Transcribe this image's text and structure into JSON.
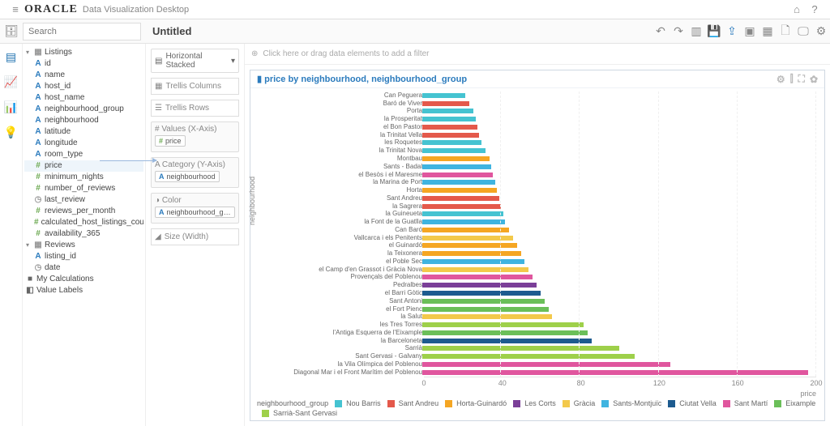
{
  "app": {
    "brand": "ORACLE",
    "subbrand": "Data Visualization Desktop"
  },
  "search": {
    "placeholder": "Search"
  },
  "canvas": {
    "title": "Untitled",
    "filter_hint": "Click here or drag data elements to add a filter"
  },
  "tree": {
    "root1": "Listings",
    "root1_items": [
      {
        "g": "A",
        "l": "id"
      },
      {
        "g": "A",
        "l": "name"
      },
      {
        "g": "A",
        "l": "host_id"
      },
      {
        "g": "A",
        "l": "host_name"
      },
      {
        "g": "A",
        "l": "neighbourhood_group"
      },
      {
        "g": "A",
        "l": "neighbourhood"
      },
      {
        "g": "A",
        "l": "latitude"
      },
      {
        "g": "A",
        "l": "longitude"
      },
      {
        "g": "A",
        "l": "room_type"
      },
      {
        "g": "H",
        "l": "price",
        "sel": true
      },
      {
        "g": "H",
        "l": "minimum_nights"
      },
      {
        "g": "H",
        "l": "number_of_reviews"
      },
      {
        "g": "C",
        "l": "last_review"
      },
      {
        "g": "H",
        "l": "reviews_per_month"
      },
      {
        "g": "H",
        "l": "calculated_host_listings_count"
      },
      {
        "g": "H",
        "l": "availability_365"
      }
    ],
    "root2": "Reviews",
    "root2_items": [
      {
        "g": "A",
        "l": "listing_id"
      },
      {
        "g": "C",
        "l": "date"
      }
    ],
    "folders": [
      {
        "g": "F",
        "l": "My Calculations"
      },
      {
        "g": "L",
        "l": "Value Labels"
      }
    ]
  },
  "grammar": {
    "viz_type": "Horizontal Stacked",
    "trellis_cols": "Trellis Columns",
    "trellis_rows": "Trellis Rows",
    "values_lbl": "Values (X-Axis)",
    "values_pill": "price",
    "category_lbl": "Category (Y-Axis)",
    "category_pill": "neighbourhood",
    "color_lbl": "Color",
    "color_pill": "neighbourhood_gr...",
    "size_lbl": "Size (Width)"
  },
  "chart": {
    "title": "price by neighbourhood, neighbourhood_group",
    "xlabel": "price",
    "ylabel": "neighbourhood",
    "legend_label": "neighbourhood_group",
    "legend_items": [
      "Nou Barris",
      "Sant Andreu",
      "Horta-Guinardó",
      "Les Corts",
      "Gràcia",
      "Sants-Montjuïc",
      "Ciutat Vella",
      "Sant Martí",
      "Eixample",
      "Sarrià-Sant Gervasi"
    ]
  },
  "chart_data": {
    "type": "bar",
    "orientation": "horizontal",
    "xlabel": "price",
    "ylabel": "neighbourhood",
    "xlim": [
      0,
      200
    ],
    "xticks": [
      0,
      40,
      80,
      120,
      160,
      200
    ],
    "color_by": "neighbourhood_group",
    "group_colors": {
      "Nou Barris": "#45c3d1",
      "Sant Andreu": "#e4594b",
      "Horta-Guinardó": "#f5a623",
      "Les Corts": "#7b3f98",
      "Gràcia": "#f3c94b",
      "Sants-Montjuïc": "#3fb4e0",
      "Ciutat Vella": "#1d5b8f",
      "Sant Martí": "#e0569e",
      "Eixample": "#6bbf59",
      "Sarrià-Sant Gervasi": "#9ed04a"
    },
    "categories": [
      "Can Peguera",
      "Baró de Viver",
      "Porta",
      "la Prosperitat",
      "el Bon Pastor",
      "la Trinitat Vella",
      "les Roquetes",
      "la Trinitat Nova",
      "Montbau",
      "Sants - Badal",
      "el Besòs i el Maresme",
      "la Marina de Port",
      "Horta",
      "Sant Andreu",
      "la Sagrera",
      "la Guineueta",
      "la Font de la Guatlla",
      "Can Baró",
      "Vallcarca i els Penitents",
      "el Guinardó",
      "la Teixonera",
      "el Poble Sec",
      "el Camp d'en Grassot i Gràcia Nova",
      "Provençals del Poblenou",
      "Pedralbes",
      "el Barri Gòtic",
      "Sant Antoni",
      "el Fort Pienc",
      "la Salut",
      "les Tres Torres",
      "l'Antiga Esquerra de l'Eixample",
      "la Barceloneta",
      "Sarrià",
      "Sant Gervasi - Galvany",
      "la Vila Olímpica del Poblenou",
      "Diagonal Mar i el Front Marítim del Poblenou"
    ],
    "values": [
      22,
      24,
      26,
      27,
      28,
      29,
      30,
      32,
      34,
      35,
      36,
      37,
      38,
      39,
      40,
      41,
      42,
      44,
      46,
      48,
      50,
      52,
      54,
      56,
      58,
      60,
      62,
      64,
      66,
      82,
      84,
      86,
      100,
      108,
      126,
      196
    ],
    "groups": [
      "Nou Barris",
      "Sant Andreu",
      "Nou Barris",
      "Nou Barris",
      "Sant Andreu",
      "Sant Andreu",
      "Nou Barris",
      "Nou Barris",
      "Horta-Guinardó",
      "Sants-Montjuïc",
      "Sant Martí",
      "Sants-Montjuïc",
      "Horta-Guinardó",
      "Sant Andreu",
      "Sant Andreu",
      "Nou Barris",
      "Sants-Montjuïc",
      "Horta-Guinardó",
      "Gràcia",
      "Horta-Guinardó",
      "Horta-Guinardó",
      "Sants-Montjuïc",
      "Gràcia",
      "Sant Martí",
      "Les Corts",
      "Ciutat Vella",
      "Eixample",
      "Eixample",
      "Gràcia",
      "Sarrià-Sant Gervasi",
      "Eixample",
      "Ciutat Vella",
      "Sarrià-Sant Gervasi",
      "Sarrià-Sant Gervasi",
      "Sant Martí",
      "Sant Martí"
    ]
  }
}
